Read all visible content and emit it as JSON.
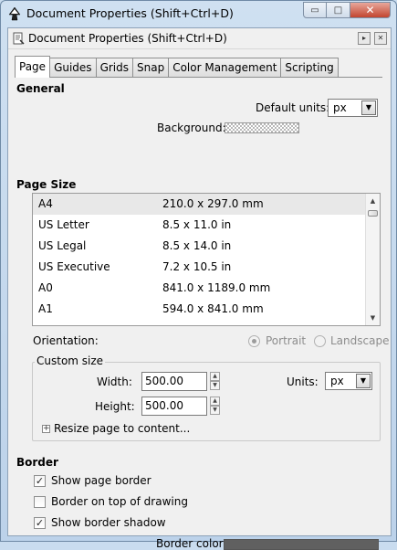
{
  "window": {
    "title": "Document Properties (Shift+Ctrl+D)",
    "minimize_glyph": "▭",
    "maximize_glyph": "□",
    "close_glyph": "✕"
  },
  "dock": {
    "title": "Document Properties (Shift+Ctrl+D)",
    "float_glyph": "▸",
    "close_glyph": "✕"
  },
  "tabs": [
    {
      "label": "Page",
      "active": true
    },
    {
      "label": "Guides",
      "active": false
    },
    {
      "label": "Grids",
      "active": false
    },
    {
      "label": "Snap",
      "active": false
    },
    {
      "label": "Color Management",
      "active": false
    },
    {
      "label": "Scripting",
      "active": false
    }
  ],
  "general": {
    "title": "General",
    "default_units_label": "Default units:",
    "default_units_value": "px",
    "background_label": "Background:"
  },
  "page_size": {
    "title": "Page Size",
    "rows": [
      {
        "name": "A4",
        "size": "210.0 x 297.0 mm",
        "selected": true
      },
      {
        "name": "US Letter",
        "size": "8.5 x 11.0 in",
        "selected": false
      },
      {
        "name": "US Legal",
        "size": "8.5 x 14.0 in",
        "selected": false
      },
      {
        "name": "US Executive",
        "size": "7.2 x 10.5 in",
        "selected": false
      },
      {
        "name": "A0",
        "size": "841.0 x 1189.0 mm",
        "selected": false
      },
      {
        "name": "A1",
        "size": "594.0 x 841.0 mm",
        "selected": false
      }
    ],
    "orientation_label": "Orientation:",
    "portrait_label": "Portrait",
    "landscape_label": "Landscape",
    "orientation_value": "Portrait"
  },
  "custom_size": {
    "title": "Custom size",
    "width_label": "Width:",
    "width_value": "500.00",
    "height_label": "Height:",
    "height_value": "500.00",
    "units_label": "Units:",
    "units_value": "px",
    "resize_label": "Resize page to content..."
  },
  "border": {
    "title": "Border",
    "show_page_border_label": "Show page border",
    "show_page_border": true,
    "border_on_top_label": "Border on top of drawing",
    "border_on_top": false,
    "show_border_shadow_label": "Show border shadow",
    "show_border_shadow": true,
    "border_color_label": "Border color:",
    "border_color": "#606060"
  },
  "colors": {
    "window_frame": "#c9dcef",
    "selected_row": "#e8e8e8"
  }
}
